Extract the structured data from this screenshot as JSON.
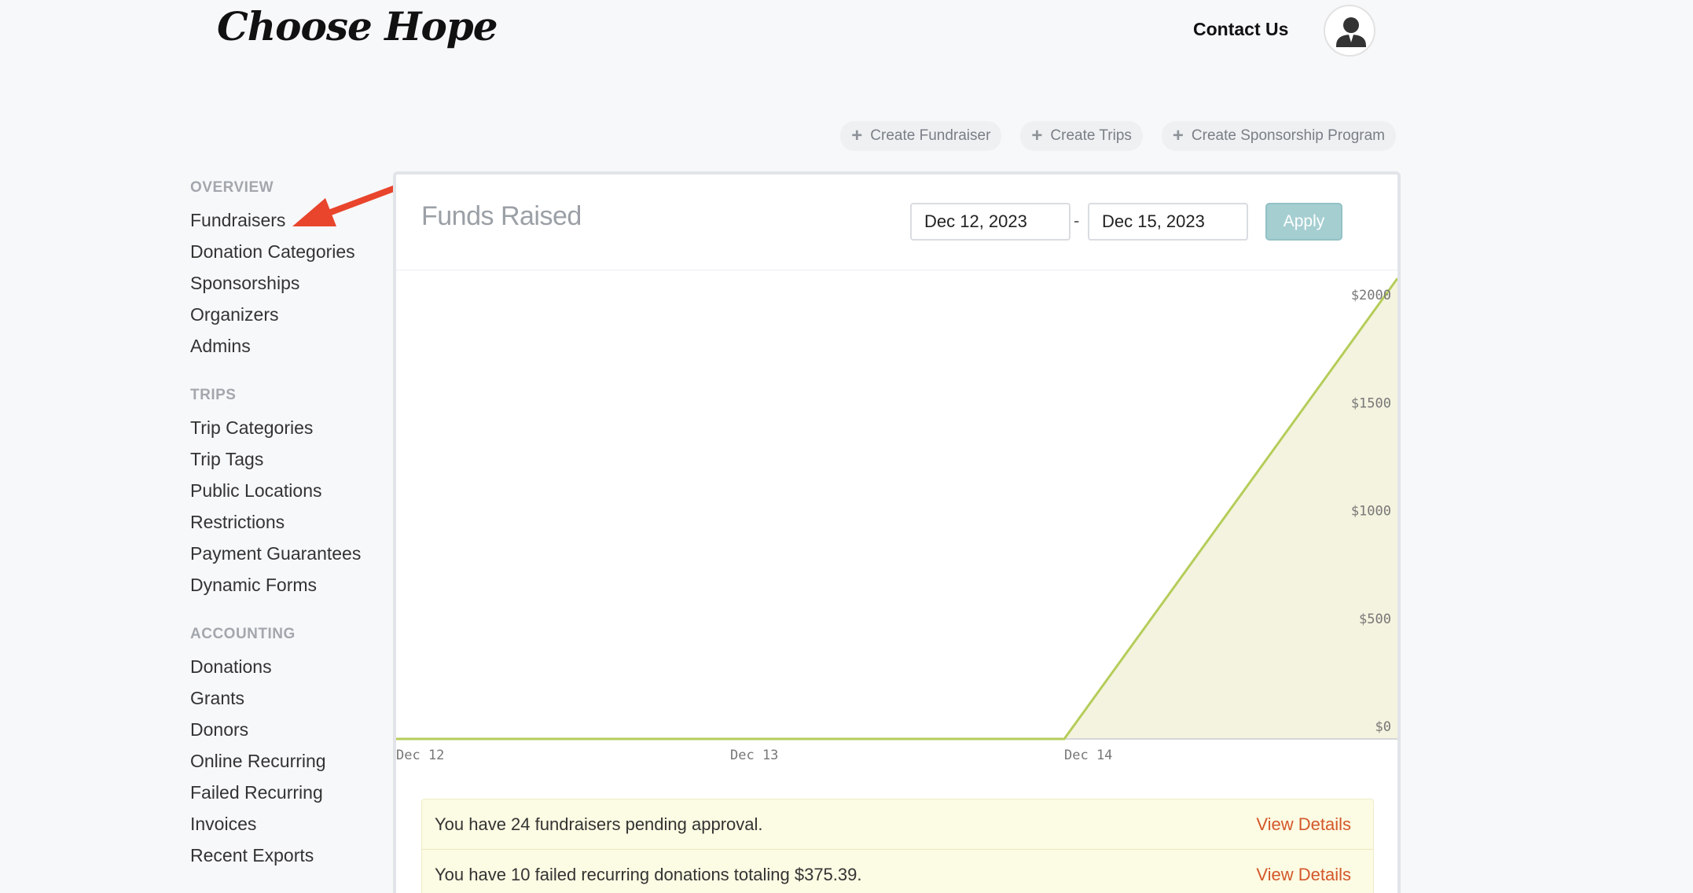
{
  "header": {
    "logo_text": "Choose Hope",
    "contact_label": "Contact Us",
    "avatar_icon": "user-avatar-icon"
  },
  "create_actions": [
    {
      "label": "Create Fundraiser",
      "icon": "plus-icon"
    },
    {
      "label": "Create Trips",
      "icon": "plus-icon"
    },
    {
      "label": "Create Sponsorship Program",
      "icon": "plus-icon"
    }
  ],
  "sidebar": {
    "sections": [
      {
        "title": "OVERVIEW",
        "items": [
          "Fundraisers",
          "Donation Categories",
          "Sponsorships",
          "Organizers",
          "Admins"
        ]
      },
      {
        "title": "TRIPS",
        "items": [
          "Trip Categories",
          "Trip Tags",
          "Public Locations",
          "Restrictions",
          "Payment Guarantees",
          "Dynamic Forms"
        ]
      },
      {
        "title": "ACCOUNTING",
        "items": [
          "Donations",
          "Grants",
          "Donors",
          "Online Recurring",
          "Failed Recurring",
          "Invoices",
          "Recent Exports"
        ]
      }
    ]
  },
  "card": {
    "title": "Funds Raised",
    "date_start": "Dec 12, 2023",
    "date_separator": "-",
    "date_end": "Dec 15, 2023",
    "apply_label": "Apply"
  },
  "chart_data": {
    "type": "area",
    "x": [
      "Dec 12",
      "Dec 13",
      "Dec 14",
      "Dec 15"
    ],
    "x_tick_labels": [
      "Dec 12",
      "Dec 13",
      "Dec 14"
    ],
    "y_tick_labels": [
      "$0",
      "$500",
      "$1000",
      "$1500",
      "$2000"
    ],
    "y_ticks": [
      0,
      500,
      1000,
      1500,
      2000
    ],
    "values": [
      0,
      0,
      0,
      2140
    ],
    "ylim": [
      0,
      2150
    ],
    "title": "",
    "xlabel": "",
    "ylabel": "",
    "line_color": "#b5cd5a",
    "fill_color": "#f4f3df",
    "grid": false
  },
  "alerts": [
    {
      "text": "You have 24 fundraisers pending approval.",
      "link": "View Details"
    },
    {
      "text": "You have 10 failed recurring donations totaling $375.39.",
      "link": "View Details"
    }
  ],
  "annotation": {
    "arrow_color": "#e8452c"
  }
}
